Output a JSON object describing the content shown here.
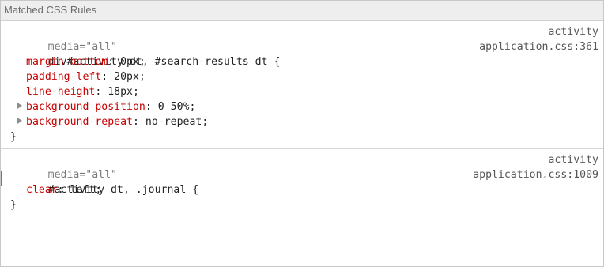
{
  "panel": {
    "title": "Matched CSS Rules"
  },
  "rules": [
    {
      "media": "media=\"all\"",
      "source_top": "activity",
      "selector": "div#activity dt, #search-results dt {",
      "source_bottom": "application.css:361",
      "declarations": [
        {
          "prop": "margin-bottom",
          "value": " 0px;"
        },
        {
          "prop": "padding-left",
          "value": " 20px;"
        },
        {
          "prop": "line-height",
          "value": " 18px;"
        },
        {
          "prop": "background-position",
          "value": " 0 50%;",
          "expandable": true
        },
        {
          "prop": "background-repeat",
          "value": " no-repeat;",
          "expandable": true
        }
      ],
      "close": "}"
    },
    {
      "media": "media=\"all\"",
      "source_top": "activity",
      "selector": "#activity dt, .journal {",
      "source_bottom": "application.css:1009",
      "declarations": [
        {
          "prop": "clear",
          "value": " left;"
        }
      ],
      "close": "}"
    }
  ]
}
